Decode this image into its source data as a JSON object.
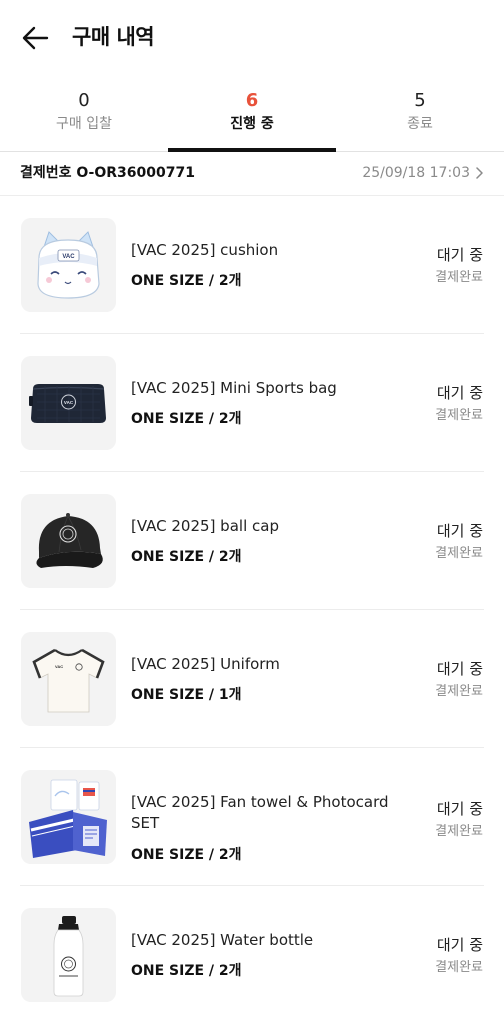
{
  "header": {
    "title": "구매 내역",
    "back_icon": "arrow-left-icon"
  },
  "tabs": [
    {
      "count": "0",
      "label": "구매 입찰",
      "active": false
    },
    {
      "count": "6",
      "label": "진행 중",
      "active": true
    },
    {
      "count": "5",
      "label": "종료",
      "active": false
    }
  ],
  "colors": {
    "accent": "#e8523b",
    "text": "#111111",
    "muted": "#8a8a8a"
  },
  "order": {
    "number": "결제번호 O-OR36000771",
    "date": "25/09/18 17:03",
    "chevron_icon": "chevron-right-icon"
  },
  "items": [
    {
      "name": "[VAC 2025] cushion",
      "option": "ONE SIZE / 2개",
      "status": "대기 중",
      "payment": "결제완료",
      "image": "cushion-image"
    },
    {
      "name": "[VAC 2025] Mini Sports bag",
      "option": "ONE SIZE / 2개",
      "status": "대기 중",
      "payment": "결제완료",
      "image": "bag-image"
    },
    {
      "name": "[VAC 2025] ball cap",
      "option": "ONE SIZE / 2개",
      "status": "대기 중",
      "payment": "결제완료",
      "image": "cap-image"
    },
    {
      "name": "[VAC 2025] Uniform",
      "option": "ONE SIZE / 1개",
      "status": "대기 중",
      "payment": "결제완료",
      "image": "uniform-image"
    },
    {
      "name": "[VAC 2025] Fan towel & Photocard SET",
      "option": "ONE SIZE / 2개",
      "status": "대기 중",
      "payment": "결제완료",
      "image": "towel-image"
    },
    {
      "name": "[VAC 2025] Water bottle",
      "option": "ONE SIZE / 2개",
      "status": "대기 중",
      "payment": "결제완료",
      "image": "bottle-image"
    }
  ]
}
